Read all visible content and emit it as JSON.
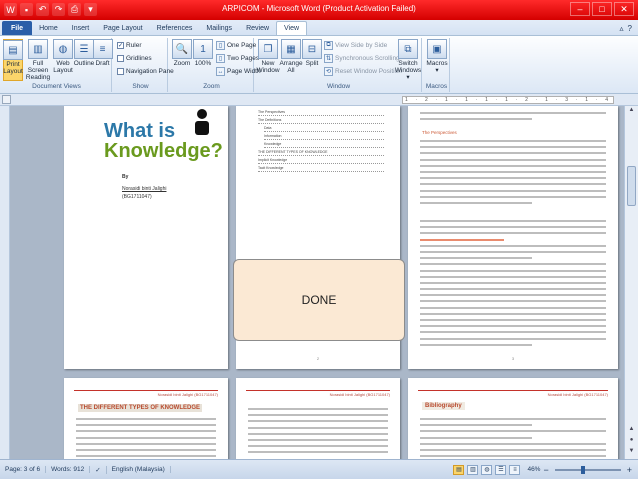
{
  "window": {
    "title": "ARPICOM - Microsoft Word (Product Activation Failed)",
    "minimize": "–",
    "maximize": "□",
    "close": "✕"
  },
  "qat": {
    "icons": [
      "word-icon",
      "save-icon",
      "undo-icon",
      "redo-icon",
      "print-icon",
      "customize-icon"
    ]
  },
  "tabs": [
    "File",
    "Home",
    "Insert",
    "Page Layout",
    "References",
    "Mailings",
    "Review",
    "View"
  ],
  "active_tab": "View",
  "ribbon": {
    "document_views": {
      "label": "Document Views",
      "print_layout": "Print\nLayout",
      "full_screen_reading": "Full Screen\nReading",
      "web_layout": "Web\nLayout",
      "outline": "Outline",
      "draft": "Draft"
    },
    "show": {
      "label": "Show",
      "ruler": "Ruler",
      "gridlines": "Gridlines",
      "navigation_pane": "Navigation Pane"
    },
    "zoom": {
      "label": "Zoom",
      "zoom": "Zoom",
      "hundred": "100%",
      "one_page": "One Page",
      "two_pages": "Two Pages",
      "page_width": "Page Width"
    },
    "window": {
      "label": "Window",
      "new_window": "New\nWindow",
      "arrange_all": "Arrange\nAll",
      "split": "Split",
      "view_side_by_side": "View Side by Side",
      "synchronous_scrolling": "Synchronous Scrolling",
      "reset_window_position": "Reset Window Position",
      "switch_windows": "Switch\nWindows ▾"
    },
    "macros": {
      "label": "Macros",
      "macros": "Macros\n▾"
    }
  },
  "ruler": {
    "text": "1 · 2 · 1 · 1 · 1 · 1 · 2 · 1 · 3 · 1 · 4 · 1 · 5 · 1 · 6 · 1 · 7 · 1 · 8 · 1 · 9 · 1 · 10 · 1 · 11 · 1 · 12 · 1"
  },
  "document": {
    "cover": {
      "what": "What is",
      "knowledge": "Knowledge?",
      "by": "By",
      "name": "Norasidi binti Jalighi",
      "id": "(BG1711047)"
    },
    "toc": {
      "rows": [
        "The Perspectives",
        "The Definitions",
        "Data",
        "Information",
        "Knowledge",
        "THE DIFFERENT TYPES OF KNOWLEDGE",
        "Implicit Knowledge",
        "Tacit Knowledge"
      ]
    },
    "page3": {
      "subtitle": "The Perspectives"
    },
    "page4": {
      "header": "Norasidi binti Jalighi (BG1711047)",
      "title": "THE DIFFERENT TYPES OF KNOWLEDGE"
    },
    "page5": {
      "header": "Norasidi binti Jalighi (BG1711047)"
    },
    "page6": {
      "header": "Norasidi binti Jalighi (BG1711047)",
      "title": "Bibliography"
    },
    "page_numbers": [
      "2",
      "3"
    ]
  },
  "overlay": {
    "done": "DONE"
  },
  "statusbar": {
    "page": "Page: 3 of 6",
    "words": "Words: 912",
    "language": "English (Malaysia)",
    "zoom_level": "46%",
    "zoom_minus": "−",
    "zoom_plus": "+"
  }
}
